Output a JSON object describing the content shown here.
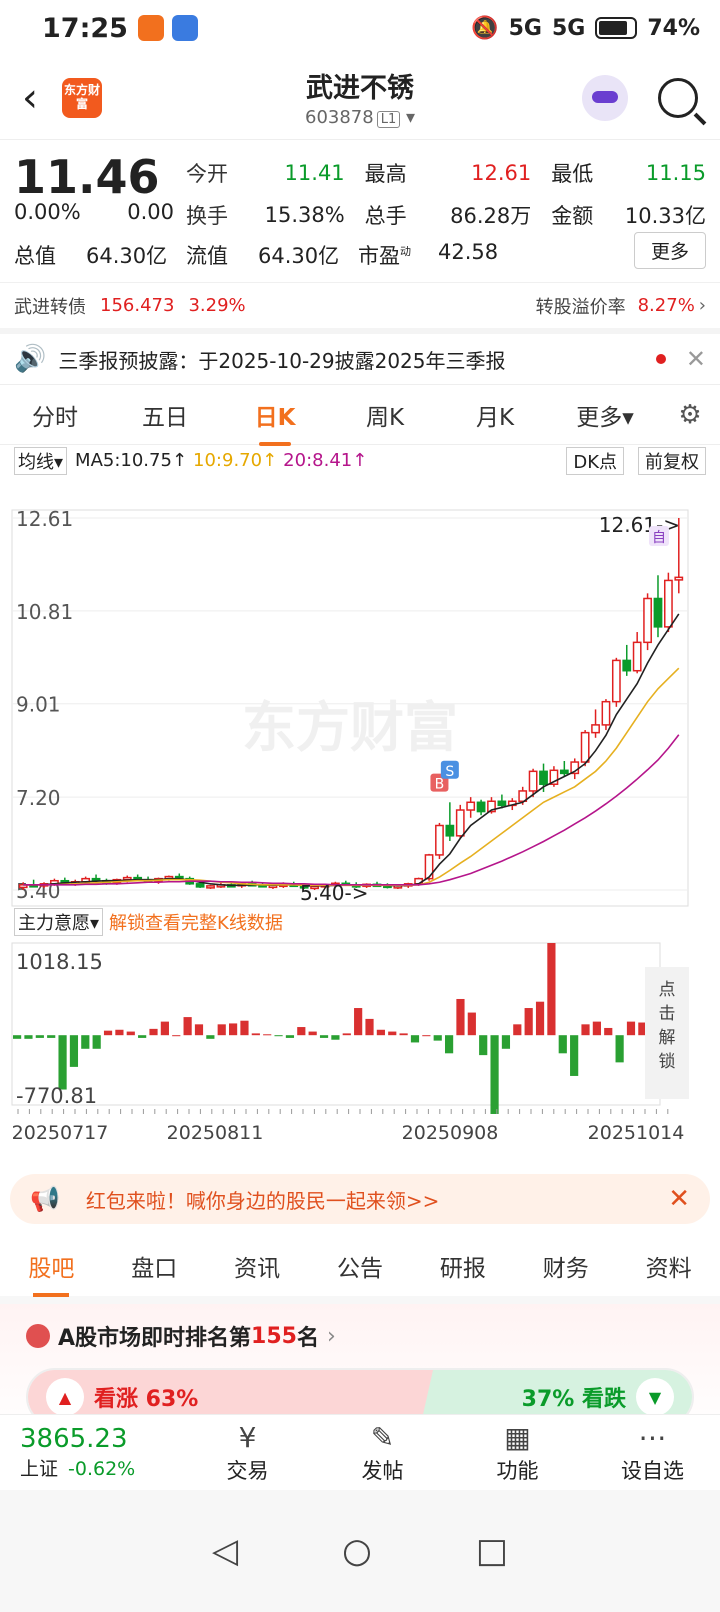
{
  "status": {
    "time": "17:25",
    "battery": "74%",
    "net1": "5G",
    "net2": "5G"
  },
  "header": {
    "logo": "东方财富",
    "name": "武进不锈",
    "code": "603878",
    "level": "L1"
  },
  "quote": {
    "price": "11.46",
    "chg_pct": "0.00%",
    "chg": "0.00",
    "row1": {
      "k1": "今开",
      "v1": "11.41",
      "k2": "最高",
      "v2": "12.61",
      "k3": "最低",
      "v3": "11.15"
    },
    "row2": {
      "k1": "换手",
      "v1": "15.38%",
      "k2": "总手",
      "v2": "86.28万",
      "k3": "金额",
      "v3": "10.33亿"
    },
    "row3": {
      "k0": "总值",
      "v0": "64.30亿",
      "k1": "流值",
      "v1": "64.30亿",
      "k2": "市盈",
      "sup": "动",
      "v2": "42.58"
    },
    "more": "更多"
  },
  "bond": {
    "name": "武进转债",
    "price": "156.473",
    "pct": "3.29%",
    "premium_label": "转股溢价率",
    "premium": "8.27%"
  },
  "notice": {
    "text": "三季报预披露：于2025-10-29披露2025年三季报"
  },
  "tabs": [
    "分时",
    "五日",
    "日K",
    "周K",
    "月K",
    "更多"
  ],
  "ma": {
    "select": "均线",
    "ma5": "MA5:10.75",
    "ma10": "10:9.70",
    "ma20": "20:8.41",
    "dk": "DK点",
    "fq": "前复权"
  },
  "chart_data": {
    "type": "candlestick",
    "y_labels": [
      "12.61",
      "10.81",
      "9.01",
      "7.20",
      "5.40"
    ],
    "ylim": [
      5.4,
      12.61
    ],
    "high_marker": "12.61->",
    "low_marker": "5.40->",
    "marks": [
      "B",
      "S",
      "自"
    ],
    "watermark": "东方财富",
    "x_labels": [
      "20250717",
      "20250811",
      "20250908",
      "20251014"
    ],
    "candles": [
      [
        5.45,
        5.55,
        5.4,
        5.5
      ],
      [
        5.5,
        5.6,
        5.45,
        5.48
      ],
      [
        5.48,
        5.55,
        5.44,
        5.52
      ],
      [
        5.52,
        5.62,
        5.48,
        5.58
      ],
      [
        5.58,
        5.64,
        5.5,
        5.53
      ],
      [
        5.53,
        5.6,
        5.48,
        5.56
      ],
      [
        5.56,
        5.66,
        5.52,
        5.62
      ],
      [
        5.62,
        5.7,
        5.55,
        5.58
      ],
      [
        5.58,
        5.62,
        5.5,
        5.55
      ],
      [
        5.55,
        5.62,
        5.5,
        5.6
      ],
      [
        5.6,
        5.68,
        5.55,
        5.64
      ],
      [
        5.64,
        5.7,
        5.58,
        5.6
      ],
      [
        5.6,
        5.66,
        5.54,
        5.58
      ],
      [
        5.58,
        5.64,
        5.52,
        5.62
      ],
      [
        5.62,
        5.68,
        5.58,
        5.66
      ],
      [
        5.66,
        5.72,
        5.6,
        5.62
      ],
      [
        5.62,
        5.66,
        5.5,
        5.52
      ],
      [
        5.52,
        5.56,
        5.44,
        5.46
      ],
      [
        5.46,
        5.5,
        5.42,
        5.48
      ],
      [
        5.48,
        5.54,
        5.44,
        5.5
      ],
      [
        5.5,
        5.56,
        5.46,
        5.49
      ],
      [
        5.49,
        5.54,
        5.44,
        5.52
      ],
      [
        5.52,
        5.58,
        5.48,
        5.5
      ],
      [
        5.5,
        5.55,
        5.45,
        5.47
      ],
      [
        5.47,
        5.52,
        5.42,
        5.49
      ],
      [
        5.49,
        5.55,
        5.44,
        5.51
      ],
      [
        5.51,
        5.56,
        5.46,
        5.48
      ],
      [
        5.48,
        5.52,
        5.42,
        5.45
      ],
      [
        5.45,
        5.5,
        5.4,
        5.47
      ],
      [
        5.47,
        5.52,
        5.43,
        5.5
      ],
      [
        5.5,
        5.56,
        5.46,
        5.53
      ],
      [
        5.53,
        5.58,
        5.48,
        5.5
      ],
      [
        5.5,
        5.55,
        5.44,
        5.48
      ],
      [
        5.48,
        5.53,
        5.44,
        5.51
      ],
      [
        5.51,
        5.56,
        5.46,
        5.49
      ],
      [
        5.49,
        5.53,
        5.43,
        5.46
      ],
      [
        5.46,
        5.5,
        5.42,
        5.48
      ],
      [
        5.48,
        5.54,
        5.44,
        5.52
      ],
      [
        5.52,
        5.64,
        5.48,
        5.62
      ],
      [
        5.62,
        6.1,
        5.58,
        6.08
      ],
      [
        6.08,
        6.7,
        6.0,
        6.65
      ],
      [
        6.65,
        7.1,
        6.35,
        6.45
      ],
      [
        6.45,
        7.05,
        6.4,
        6.95
      ],
      [
        6.95,
        7.2,
        6.8,
        7.1
      ],
      [
        7.1,
        7.15,
        6.85,
        6.92
      ],
      [
        6.92,
        7.2,
        6.88,
        7.12
      ],
      [
        7.12,
        7.25,
        6.98,
        7.04
      ],
      [
        7.04,
        7.18,
        6.95,
        7.12
      ],
      [
        7.12,
        7.4,
        7.05,
        7.32
      ],
      [
        7.32,
        7.75,
        7.2,
        7.7
      ],
      [
        7.7,
        7.85,
        7.3,
        7.45
      ],
      [
        7.45,
        7.8,
        7.4,
        7.72
      ],
      [
        7.72,
        7.9,
        7.6,
        7.66
      ],
      [
        7.66,
        7.95,
        7.55,
        7.88
      ],
      [
        7.88,
        8.5,
        7.8,
        8.45
      ],
      [
        8.45,
        8.9,
        8.35,
        8.6
      ],
      [
        8.6,
        9.1,
        8.5,
        9.05
      ],
      [
        9.05,
        9.9,
        8.95,
        9.85
      ],
      [
        9.85,
        10.15,
        9.55,
        9.65
      ],
      [
        9.65,
        10.4,
        9.6,
        10.2
      ],
      [
        10.2,
        11.15,
        10.05,
        11.05
      ],
      [
        11.05,
        11.5,
        10.3,
        10.5
      ],
      [
        10.5,
        11.55,
        10.4,
        11.4
      ],
      [
        11.41,
        12.61,
        11.15,
        11.46
      ]
    ],
    "ma5": [
      5.5,
      5.5,
      5.5,
      5.52,
      5.54,
      5.55,
      5.56,
      5.57,
      5.58,
      5.58,
      5.59,
      5.6,
      5.6,
      5.6,
      5.62,
      5.62,
      5.59,
      5.55,
      5.52,
      5.5,
      5.49,
      5.49,
      5.5,
      5.5,
      5.49,
      5.5,
      5.5,
      5.49,
      5.48,
      5.48,
      5.49,
      5.5,
      5.5,
      5.5,
      5.5,
      5.49,
      5.48,
      5.49,
      5.52,
      5.65,
      5.9,
      6.1,
      6.4,
      6.65,
      6.8,
      6.95,
      7.0,
      7.05,
      7.1,
      7.25,
      7.4,
      7.5,
      7.6,
      7.7,
      7.85,
      8.1,
      8.4,
      8.8,
      9.1,
      9.4,
      9.8,
      10.15,
      10.45,
      10.75
    ],
    "ma10": [
      5.5,
      5.5,
      5.5,
      5.5,
      5.51,
      5.52,
      5.53,
      5.54,
      5.55,
      5.56,
      5.57,
      5.58,
      5.58,
      5.59,
      5.6,
      5.6,
      5.6,
      5.59,
      5.57,
      5.55,
      5.54,
      5.52,
      5.51,
      5.5,
      5.5,
      5.5,
      5.5,
      5.49,
      5.49,
      5.49,
      5.49,
      5.49,
      5.49,
      5.49,
      5.49,
      5.49,
      5.49,
      5.49,
      5.5,
      5.55,
      5.65,
      5.78,
      5.92,
      6.05,
      6.2,
      6.35,
      6.5,
      6.65,
      6.8,
      6.95,
      7.1,
      7.2,
      7.3,
      7.4,
      7.55,
      7.7,
      7.9,
      8.15,
      8.45,
      8.75,
      9.05,
      9.3,
      9.5,
      9.7
    ],
    "ma20": [
      5.5,
      5.5,
      5.5,
      5.5,
      5.5,
      5.5,
      5.51,
      5.51,
      5.52,
      5.52,
      5.53,
      5.54,
      5.55,
      5.55,
      5.56,
      5.56,
      5.57,
      5.57,
      5.57,
      5.56,
      5.56,
      5.55,
      5.55,
      5.54,
      5.53,
      5.53,
      5.52,
      5.52,
      5.51,
      5.51,
      5.5,
      5.5,
      5.5,
      5.5,
      5.5,
      5.5,
      5.5,
      5.5,
      5.5,
      5.52,
      5.55,
      5.6,
      5.66,
      5.72,
      5.8,
      5.88,
      5.96,
      6.05,
      6.14,
      6.24,
      6.34,
      6.45,
      6.56,
      6.68,
      6.8,
      6.93,
      7.07,
      7.22,
      7.38,
      7.55,
      7.73,
      7.92,
      8.15,
      8.41
    ]
  },
  "mainflow": {
    "select": "主力意愿",
    "unlock": "解锁查看完整K线数据",
    "max": "1018.15",
    "min": "-770.81",
    "side": "点击解锁",
    "bars": [
      -40,
      -40,
      -30,
      -30,
      -600,
      -350,
      -150,
      -150,
      50,
      60,
      40,
      -30,
      70,
      150,
      0,
      200,
      120,
      -40,
      120,
      130,
      160,
      20,
      10,
      -10,
      -30,
      90,
      40,
      -30,
      -50,
      20,
      300,
      180,
      60,
      40,
      20,
      -80,
      0,
      -60,
      -200,
      400,
      250,
      -220,
      -870,
      -150,
      120,
      300,
      370,
      1018,
      -200,
      -450,
      120,
      150,
      80,
      -300,
      150,
      140,
      -80
    ]
  },
  "banner": {
    "text": "红包来啦！喊你身边的股民一起来领>>"
  },
  "btabs": [
    "股吧",
    "盘口",
    "资讯",
    "公告",
    "研报",
    "财务",
    "资料"
  ],
  "rank": {
    "pre": "A股市场即时排名第",
    "num": "155",
    "post": "名",
    "up": "看涨 63%",
    "down": "37% 看跌"
  },
  "bottom": {
    "index": "3865.23",
    "index_name": "上证",
    "index_chg": "-0.62%",
    "items": [
      "交易",
      "发帖",
      "功能",
      "设自选"
    ]
  }
}
